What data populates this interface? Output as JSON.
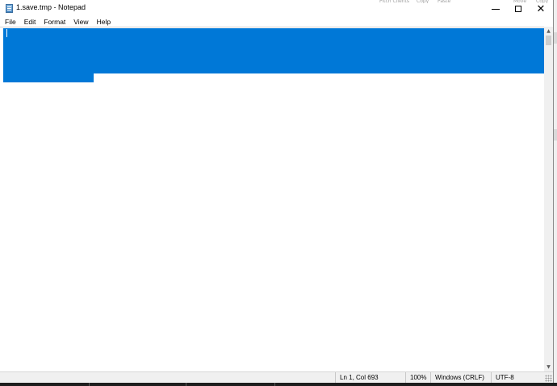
{
  "window": {
    "title": "1.save.tmp - Notepad",
    "icon": "notepad-icon",
    "controls": {
      "minimize_icon": "minimize-icon",
      "maximize_icon": "maximize-icon",
      "close_icon": "close-icon",
      "close_glyph": "✕"
    }
  },
  "menu": {
    "items": [
      {
        "label": "File"
      },
      {
        "label": "Edit"
      },
      {
        "label": "Format"
      },
      {
        "label": "View"
      },
      {
        "label": "Help"
      }
    ]
  },
  "editor": {
    "selection_color": "#0078d7",
    "has_selection": true
  },
  "scrollbar": {
    "up_glyph": "▲",
    "down_glyph": "▼"
  },
  "status": {
    "position": "Ln 1, Col 693",
    "zoom": "100%",
    "line_ending": "Windows (CRLF)",
    "encoding": "UTF-8"
  },
  "background": {
    "fragments": [
      "Pitch Clients",
      "Copy",
      "Paste",
      "Move",
      "Copy"
    ]
  },
  "colors": {
    "selection": "#0078d7",
    "statusbar": "#f0f0f0",
    "scrollbar": "#f0f0f0"
  }
}
